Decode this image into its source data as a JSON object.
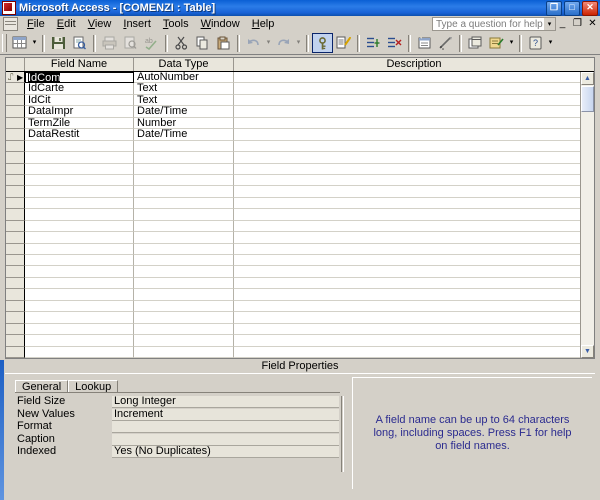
{
  "window": {
    "title": "Microsoft Access - [COMENZI : Table]",
    "app_icon": "access-icon",
    "restore_button": "❐",
    "maximize_button": "□",
    "close_button": "✕",
    "doc_minimize": "_",
    "doc_restore": "❐",
    "doc_close": "✕"
  },
  "menubar": {
    "items": [
      {
        "label": "File",
        "accel": "F"
      },
      {
        "label": "Edit",
        "accel": "E"
      },
      {
        "label": "View",
        "accel": "V"
      },
      {
        "label": "Insert",
        "accel": "I"
      },
      {
        "label": "Tools",
        "accel": "T"
      },
      {
        "label": "Window",
        "accel": "W"
      },
      {
        "label": "Help",
        "accel": "H"
      }
    ],
    "help_question": {
      "placeholder": "Type a question for help",
      "value": "",
      "dropdown_arrow": "▾"
    }
  },
  "toolbar": {
    "buttons": [
      {
        "name": "view-button",
        "icon": "datasheet-view-icon",
        "enabled": true,
        "pressed": false
      },
      {
        "name": "view-dropdown",
        "icon": "chevron-down-icon",
        "enabled": true,
        "pressed": false
      },
      {
        "name": "save-button",
        "icon": "floppy-disk-icon",
        "enabled": true,
        "pressed": false
      },
      {
        "name": "search-button",
        "icon": "file-search-icon",
        "enabled": true,
        "pressed": false
      },
      {
        "name": "print-button",
        "icon": "printer-icon",
        "enabled": false,
        "pressed": false
      },
      {
        "name": "print-preview-button",
        "icon": "print-preview-icon",
        "enabled": false,
        "pressed": false
      },
      {
        "name": "spelling-button",
        "icon": "spell-check-icon",
        "enabled": false,
        "pressed": false
      },
      {
        "name": "cut-button",
        "icon": "scissors-icon",
        "enabled": true,
        "pressed": false
      },
      {
        "name": "copy-button",
        "icon": "copy-icon",
        "enabled": true,
        "pressed": false
      },
      {
        "name": "paste-button",
        "icon": "clipboard-paste-icon",
        "enabled": true,
        "pressed": false
      },
      {
        "name": "undo-button",
        "icon": "undo-arrow-icon",
        "enabled": false,
        "pressed": false
      },
      {
        "name": "undo-dropdown",
        "icon": "chevron-down-icon",
        "enabled": false,
        "pressed": false
      },
      {
        "name": "redo-button",
        "icon": "redo-arrow-icon",
        "enabled": false,
        "pressed": false
      },
      {
        "name": "redo-dropdown",
        "icon": "chevron-down-icon",
        "enabled": false,
        "pressed": false
      },
      {
        "name": "primary-key-button",
        "icon": "key-icon",
        "enabled": true,
        "pressed": true
      },
      {
        "name": "indexes-button",
        "icon": "indexes-icon",
        "enabled": true,
        "pressed": false
      },
      {
        "name": "insert-rows-button",
        "icon": "insert-rows-icon",
        "enabled": true,
        "pressed": false
      },
      {
        "name": "delete-rows-button",
        "icon": "delete-rows-icon",
        "enabled": true,
        "pressed": false
      },
      {
        "name": "properties-button",
        "icon": "properties-icon",
        "enabled": true,
        "pressed": false
      },
      {
        "name": "build-button",
        "icon": "build-wand-icon",
        "enabled": true,
        "pressed": false
      },
      {
        "name": "database-window-button",
        "icon": "database-window-icon",
        "enabled": true,
        "pressed": false
      },
      {
        "name": "new-object-button",
        "icon": "new-object-icon",
        "enabled": true,
        "pressed": false
      },
      {
        "name": "new-object-dropdown",
        "icon": "chevron-down-icon",
        "enabled": true,
        "pressed": false
      },
      {
        "name": "help-button",
        "icon": "question-mark-icon",
        "enabled": true,
        "pressed": false
      },
      {
        "name": "toolbar-options",
        "icon": "chevron-down-icon",
        "enabled": true,
        "pressed": false
      }
    ]
  },
  "grid": {
    "headers": {
      "selector": "",
      "field_name": "Field Name",
      "data_type": "Data Type",
      "description": "Description"
    },
    "rows": [
      {
        "field_name": "IdCom",
        "data_type": "AutoNumber",
        "description": "",
        "primary_key": true,
        "current": true
      },
      {
        "field_name": "IdCarte",
        "data_type": "Text",
        "description": "",
        "primary_key": false,
        "current": false
      },
      {
        "field_name": "IdCit",
        "data_type": "Text",
        "description": "",
        "primary_key": false,
        "current": false
      },
      {
        "field_name": "DataImpr",
        "data_type": "Date/Time",
        "description": "",
        "primary_key": false,
        "current": false
      },
      {
        "field_name": "TermZile",
        "data_type": "Number",
        "description": "",
        "primary_key": false,
        "current": false
      },
      {
        "field_name": "DataRestit",
        "data_type": "Date/Time",
        "description": "",
        "primary_key": false,
        "current": false
      }
    ],
    "empty_row_count": 19,
    "scrollbar": {
      "up_arrow": "▲",
      "down_arrow": "▼"
    },
    "key_glyph": "⑀",
    "row_arrow": "▶"
  },
  "field_properties": {
    "header": "Field Properties",
    "tabs": [
      {
        "label": "General",
        "active": true
      },
      {
        "label": "Lookup",
        "active": false
      }
    ],
    "properties": [
      {
        "label": "Field Size",
        "value": "Long Integer"
      },
      {
        "label": "New Values",
        "value": "Increment"
      },
      {
        "label": "Format",
        "value": ""
      },
      {
        "label": "Caption",
        "value": ""
      },
      {
        "label": "Indexed",
        "value": "Yes (No Duplicates)"
      }
    ],
    "help_text": "A field name can be up to 64 characters long, including spaces.  Press F1 for help on field names."
  },
  "colors": {
    "title_blue": "#1165d8",
    "face": "#d4d0c8",
    "grid_header": "#e9e6dc",
    "help_text_blue": "#2b2b8f"
  }
}
